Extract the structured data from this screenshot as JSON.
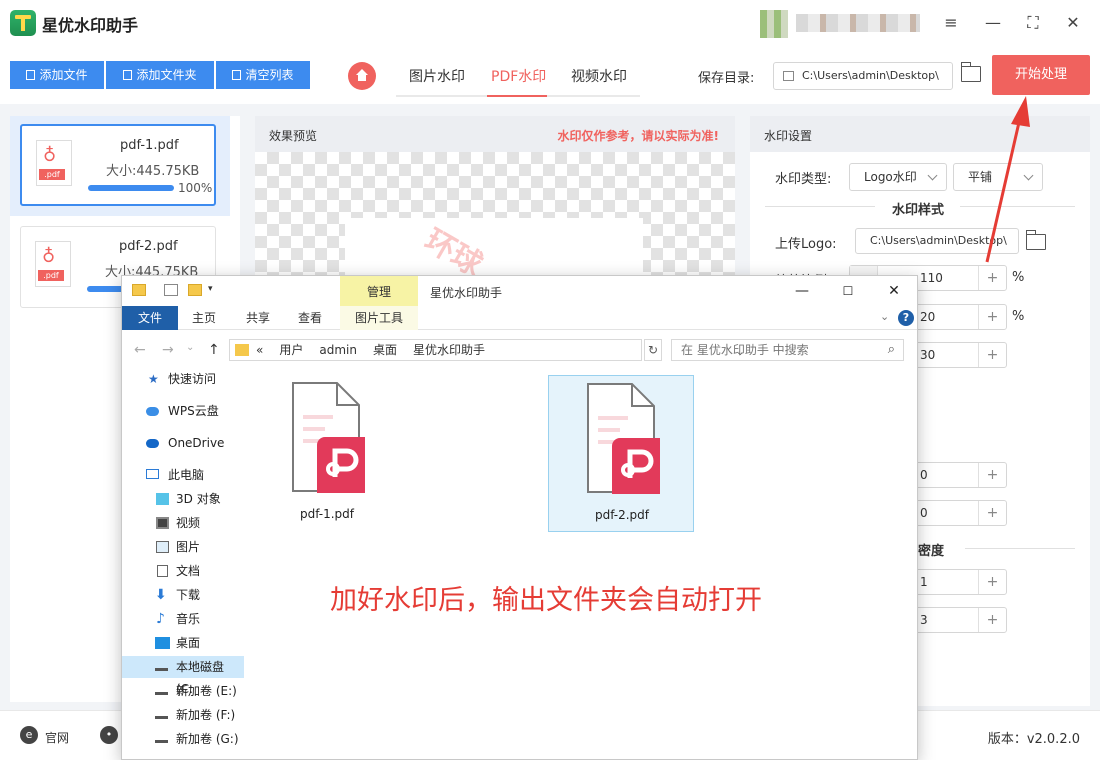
{
  "app": {
    "title": "星优水印助手",
    "window_controls": [
      "≡",
      "—",
      "⛶",
      "✕"
    ]
  },
  "toolbar": {
    "add_file": "添加文件",
    "add_folder": "添加文件夹",
    "clear_list": "清空列表"
  },
  "tabs": [
    {
      "label": "图片水印",
      "active": false
    },
    {
      "label": "PDF水印",
      "active": true
    },
    {
      "label": "视频水印",
      "active": false
    }
  ],
  "save": {
    "label": "保存目录:",
    "path": "C:\\Users\\admin\\Desktop\\"
  },
  "start_button": "开始处理",
  "files": [
    {
      "name": "pdf-1.pdf",
      "size": "大小:445.75KB",
      "progress": 1.0,
      "progress_text": "100%",
      "selected": true
    },
    {
      "name": "pdf-2.pdf",
      "size": "大小:445.75KB",
      "progress": 0.5,
      "progress_text": "",
      "selected": false
    }
  ],
  "preview": {
    "title": "效果预览",
    "note": "水印仅作参考，请以实际为准!",
    "watermark_text": "环球"
  },
  "settings": {
    "title": "水印设置",
    "type_label": "水印类型:",
    "type_value": "Logo水印",
    "layout_value": "平铺",
    "style_section": "水印样式",
    "upload_logo_label": "上传Logo:",
    "upload_logo_path": "C:\\Users\\admin\\Desktop\\",
    "scale_label": "缩放比例",
    "steppers": [
      {
        "value": "110",
        "unit": "%"
      },
      {
        "value": "20",
        "unit": "%"
      },
      {
        "value": "30",
        "unit": ""
      },
      {
        "value": "0",
        "unit": ""
      },
      {
        "value": "0",
        "unit": ""
      },
      {
        "value": "1",
        "unit": ""
      },
      {
        "value": "3",
        "unit": ""
      }
    ],
    "density_section": "密度"
  },
  "footer": {
    "site": "官网",
    "version": "版本：v2.0.2.0"
  },
  "explorer": {
    "title": "星优水印助手",
    "manage_tab": "管理",
    "ribbon_tabs": [
      "文件",
      "主页",
      "共享",
      "查看",
      "图片工具"
    ],
    "breadcrumbs": [
      "«",
      "用户",
      "admin",
      "桌面",
      "星优水印助手"
    ],
    "search_placeholder": "在 星优水印助手 中搜索",
    "nav_items": [
      {
        "label": "快速访问",
        "icon": "star-icon"
      },
      {
        "label": "WPS云盘",
        "icon": "cloud-icon"
      },
      {
        "label": "OneDrive",
        "icon": "onedrive-icon"
      },
      {
        "label": "此电脑",
        "icon": "computer-icon"
      },
      {
        "label": "3D 对象",
        "icon": "cube-icon"
      },
      {
        "label": "视频",
        "icon": "video-icon"
      },
      {
        "label": "图片",
        "icon": "picture-icon"
      },
      {
        "label": "文档",
        "icon": "document-icon"
      },
      {
        "label": "下载",
        "icon": "download-icon"
      },
      {
        "label": "音乐",
        "icon": "music-icon"
      },
      {
        "label": "桌面",
        "icon": "desktop-icon"
      },
      {
        "label": "本地磁盘 (C:",
        "icon": "disk-icon"
      },
      {
        "label": "新加卷 (E:)",
        "icon": "drive-icon"
      },
      {
        "label": "新加卷 (F:)",
        "icon": "drive-icon"
      },
      {
        "label": "新加卷 (G:)",
        "icon": "drive-icon"
      }
    ],
    "files": [
      {
        "name": "pdf-1.pdf",
        "selected": false
      },
      {
        "name": "pdf-2.pdf",
        "selected": true
      }
    ]
  },
  "annotation": "加好水印后，输出文件夹会自动打开",
  "colors": {
    "accent_blue": "#3d8bef",
    "accent_red": "#f0625e",
    "annotation_red": "#e53c35",
    "wps_pdf_red": "#e23a5a"
  }
}
